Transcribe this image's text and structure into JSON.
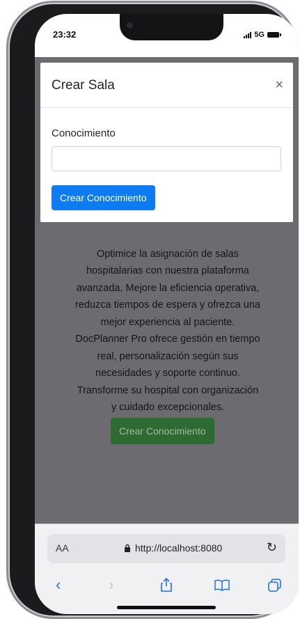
{
  "status_bar": {
    "time": "23:32",
    "network": "5G"
  },
  "modal": {
    "title": "Crear Sala",
    "close_symbol": "×",
    "field_label": "Conocimiento",
    "field_value": "",
    "field_placeholder": "",
    "submit_label": "Crear Conocimiento"
  },
  "background": {
    "description": "Optimice la asignación de salas hospitalarias con nuestra plataforma avanzada. Mejore la eficiencia operativa, reduzca tiempos de espera y ofrezca una mejor experiencia al paciente. DocPlanner Pro ofrece gestión en tiempo real, personalización según sus necesidades y soporte continuo. Transforme su hospital con organización y cuidado excepcionales.",
    "button_label": "Crear Conocimiento"
  },
  "browser": {
    "text_size_label": "AA",
    "url": "http://localhost:8080",
    "reload_icon": "reload-icon",
    "back_icon": "back-icon",
    "forward_icon": "forward-icon",
    "share_icon": "share-icon",
    "bookmarks_icon": "bookmarks-icon",
    "tabs_icon": "tabs-icon"
  },
  "colors": {
    "primary": "#0d7cf2",
    "success_dimmed": "#2e6b33",
    "overlay": "#6c6c70"
  }
}
